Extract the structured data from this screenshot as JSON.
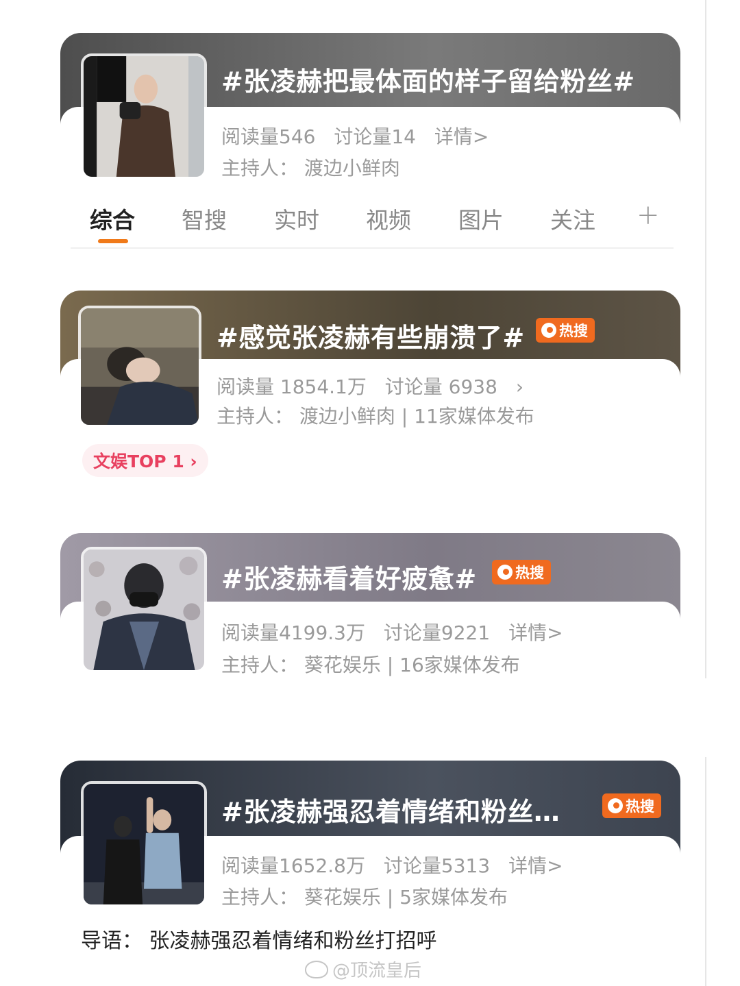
{
  "colors": {
    "card1_banner": "#6a6a6a",
    "card2_banner": "#5d5446",
    "card3_banner": "#8b8790",
    "card4_banner": "#3d4450",
    "hot_badge": "#f06a1f",
    "tab_underline": "#f07a1a",
    "top_pill_text": "#e8405f"
  },
  "cards": [
    {
      "title": "#张凌赫把最体面的样子留给粉丝#",
      "stats": [
        "阅读量546",
        "讨论量14",
        "详情>"
      ],
      "host": "主持人：  渡边小鲜肉",
      "badge": ""
    },
    {
      "title": "#感觉张凌赫有些崩溃了#",
      "stats": [
        "阅读量 1854.1万",
        "讨论量 6938",
        "  ›"
      ],
      "host": "主持人：  渡边小鲜肉 | 11家媒体发布",
      "badge": "热搜"
    },
    {
      "title": "#张凌赫看着好疲惫#",
      "stats": [
        "阅读量4199.3万",
        "讨论量9221",
        "详情>"
      ],
      "host": "主持人：  葵花娱乐 | 16家媒体发布",
      "badge": "热搜"
    },
    {
      "title": "#张凌赫强忍着情绪和粉丝…",
      "stats": [
        "阅读量1652.8万",
        "讨论量5313",
        "详情>"
      ],
      "host": "主持人：  葵花娱乐 | 5家媒体发布",
      "badge": "热搜"
    }
  ],
  "tabs": [
    "综合",
    "智搜",
    "实时",
    "视频",
    "图片",
    "关注"
  ],
  "tab_plus": "+",
  "top_pill": "文娱TOP 1 ›",
  "intro": "导语：  张凌赫强忍着情绪和粉丝打招呼",
  "watermark": "@顶流皇后"
}
